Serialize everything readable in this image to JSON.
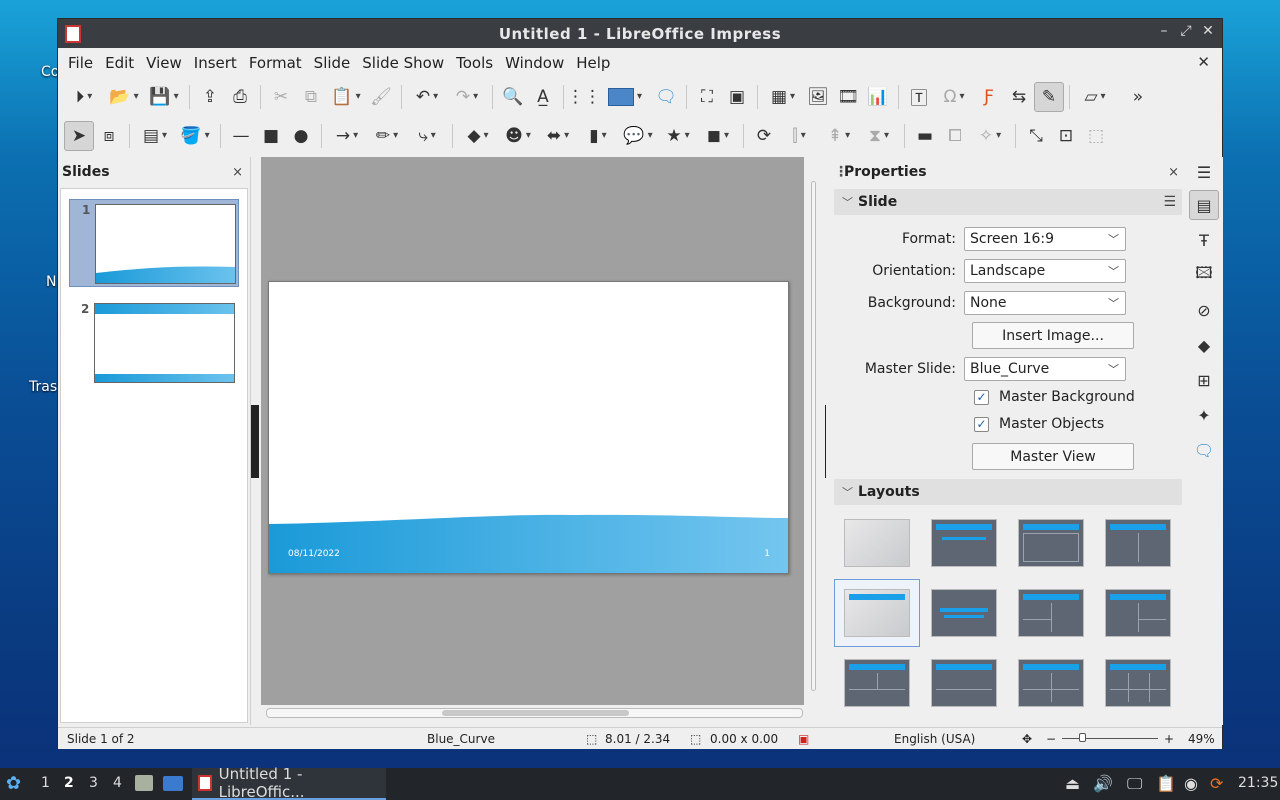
{
  "desktop": {
    "labels": [
      "Co",
      "N",
      "Tras"
    ]
  },
  "window": {
    "title": "Untitled 1 - LibreOffice Impress",
    "controls": [
      "–",
      "⤢",
      "✕"
    ]
  },
  "menu": [
    "File",
    "Edit",
    "View",
    "Insert",
    "Format",
    "Slide",
    "Slide Show",
    "Tools",
    "Window",
    "Help"
  ],
  "slides_panel": {
    "title": "Slides",
    "close": "×",
    "items": [
      {
        "num": "1"
      },
      {
        "num": "2"
      }
    ]
  },
  "slide": {
    "date": "08/11/2022",
    "number": "1"
  },
  "properties": {
    "title": "Properties",
    "close": "×",
    "slide_section": "Slide",
    "format_label": "Format:",
    "format_value": "Screen 16:9",
    "orientation_label": "Orientation:",
    "orientation_value": "Landscape",
    "background_label": "Background:",
    "background_value": "None",
    "insert_image": "Insert Image...",
    "master_slide_label": "Master Slide:",
    "master_slide_value": "Blue_Curve",
    "master_background": "Master Background",
    "master_objects": "Master Objects",
    "master_view": "Master View",
    "layouts_section": "Layouts"
  },
  "status": {
    "slide": "Slide 1 of 2",
    "master": "Blue_Curve",
    "position": "8.01 / 2.34",
    "size": "0.00 x 0.00",
    "language": "English (USA)",
    "zoom_minus": "−",
    "zoom_plus": "+",
    "zoom": "49%"
  },
  "taskbar": {
    "workspaces": [
      "1",
      "2",
      "3",
      "4"
    ],
    "task_label": "Untitled 1 - LibreOffic...",
    "clock": "21:35"
  },
  "colors": {
    "accent": "#1aa0dc",
    "titlebar": "#3a3d42",
    "taskbar": "#22262b"
  }
}
